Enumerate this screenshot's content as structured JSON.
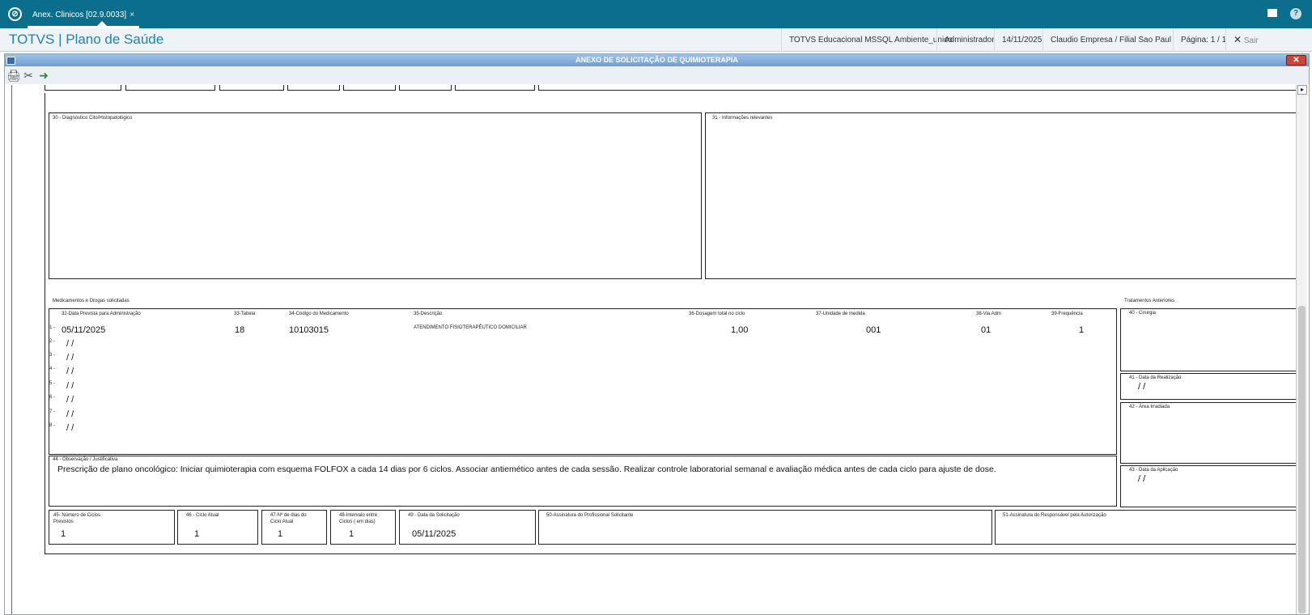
{
  "topbar": {
    "tab_label": "Anex. Clinicos [02.9.0033]",
    "tab_close": "×"
  },
  "header": {
    "brand": "TOTVS | Plano de Saúde",
    "environment": "TOTVS Educacional MSSQL Ambiente_unico",
    "user": "Administrador",
    "date": "14/11/2025",
    "company": "Claudio Empresa / Filial Sao Paul",
    "page": "Página: 1 / 1",
    "exit": "Sair"
  },
  "window": {
    "title": "ANEXO DE SOLICITAÇÃO DE QUIMIOTERAPIA"
  },
  "form": {
    "f30_label": "30 - Diagnóstico Cito/Histopatológico",
    "f31_label": "31 - Informações relevantes",
    "meds_title": "Medicamentos e Drogas solicitadas",
    "prev_title": "Tratamentos Anteriores",
    "col32": "32-Data Prevista para Administração",
    "col33": "33-Tabela",
    "col34": "34-Código do Medicamento",
    "col35": "35-Descrição",
    "col36": "36-Dosagem total no ciclo",
    "col37": "37-Unidade de medida",
    "col38": "38-Via Adm",
    "col39": "39-Frequência",
    "rows": [
      {
        "num": "1 -",
        "date": "05/11/2025",
        "tabela": "18",
        "codigo": "10103015",
        "descricao": "ATENDIMENTO FISIOTERAPÊUTICO DOMICILIAR",
        "dosagem": "1,00",
        "unidade": "001",
        "via": "01",
        "freq": "1"
      },
      {
        "num": "2 -",
        "date": "/ /"
      },
      {
        "num": "3 -",
        "date": "/ /"
      },
      {
        "num": "4 -",
        "date": "/ /"
      },
      {
        "num": "5 -",
        "date": "/ /"
      },
      {
        "num": "6 -",
        "date": "/ /"
      },
      {
        "num": "7 -",
        "date": "/ /"
      },
      {
        "num": "8 -",
        "date": "/ /"
      }
    ],
    "f40_label": "40 - Cirurgia",
    "f41_label": "41 - Data da Realização",
    "f41_value": "/ /",
    "f42_label": "42 - Área Irradiada",
    "f43_label": "43 - Data da Aplicação",
    "f43_value": "/ /",
    "f44_label": "44 - Observação / Justificativa",
    "f44_value": "Prescrição de plano oncológico: Iniciar quimioterapia com esquema FOLFOX a cada 14 dias por 6 ciclos. Associar antiemético antes de cada sessão. Realizar controle laboratorial semanal e avaliação médica antes de cada ciclo para ajuste de dose.",
    "f45_label_1": "45- Número de Ciclos",
    "f45_label_2": "Previstos",
    "f45_value": "1",
    "f46_label": "46 - Ciclo Atual",
    "f46_value": "1",
    "f47_label_1": "47-Nº de dias do",
    "f47_label_2": "Ciclo Atual",
    "f47_value": "1",
    "f48_label_1": "48-Intervalo entre",
    "f48_label_2": "Ciclos ( em dias)",
    "f48_value": "1",
    "f49_label": "49 - Data da Solicitação",
    "f49_value": "05/11/2025",
    "f50_label": "50-Assinatura do Profissional Solicitante",
    "f51_label": "51-Assinatura do Responsável pela Autorização"
  }
}
